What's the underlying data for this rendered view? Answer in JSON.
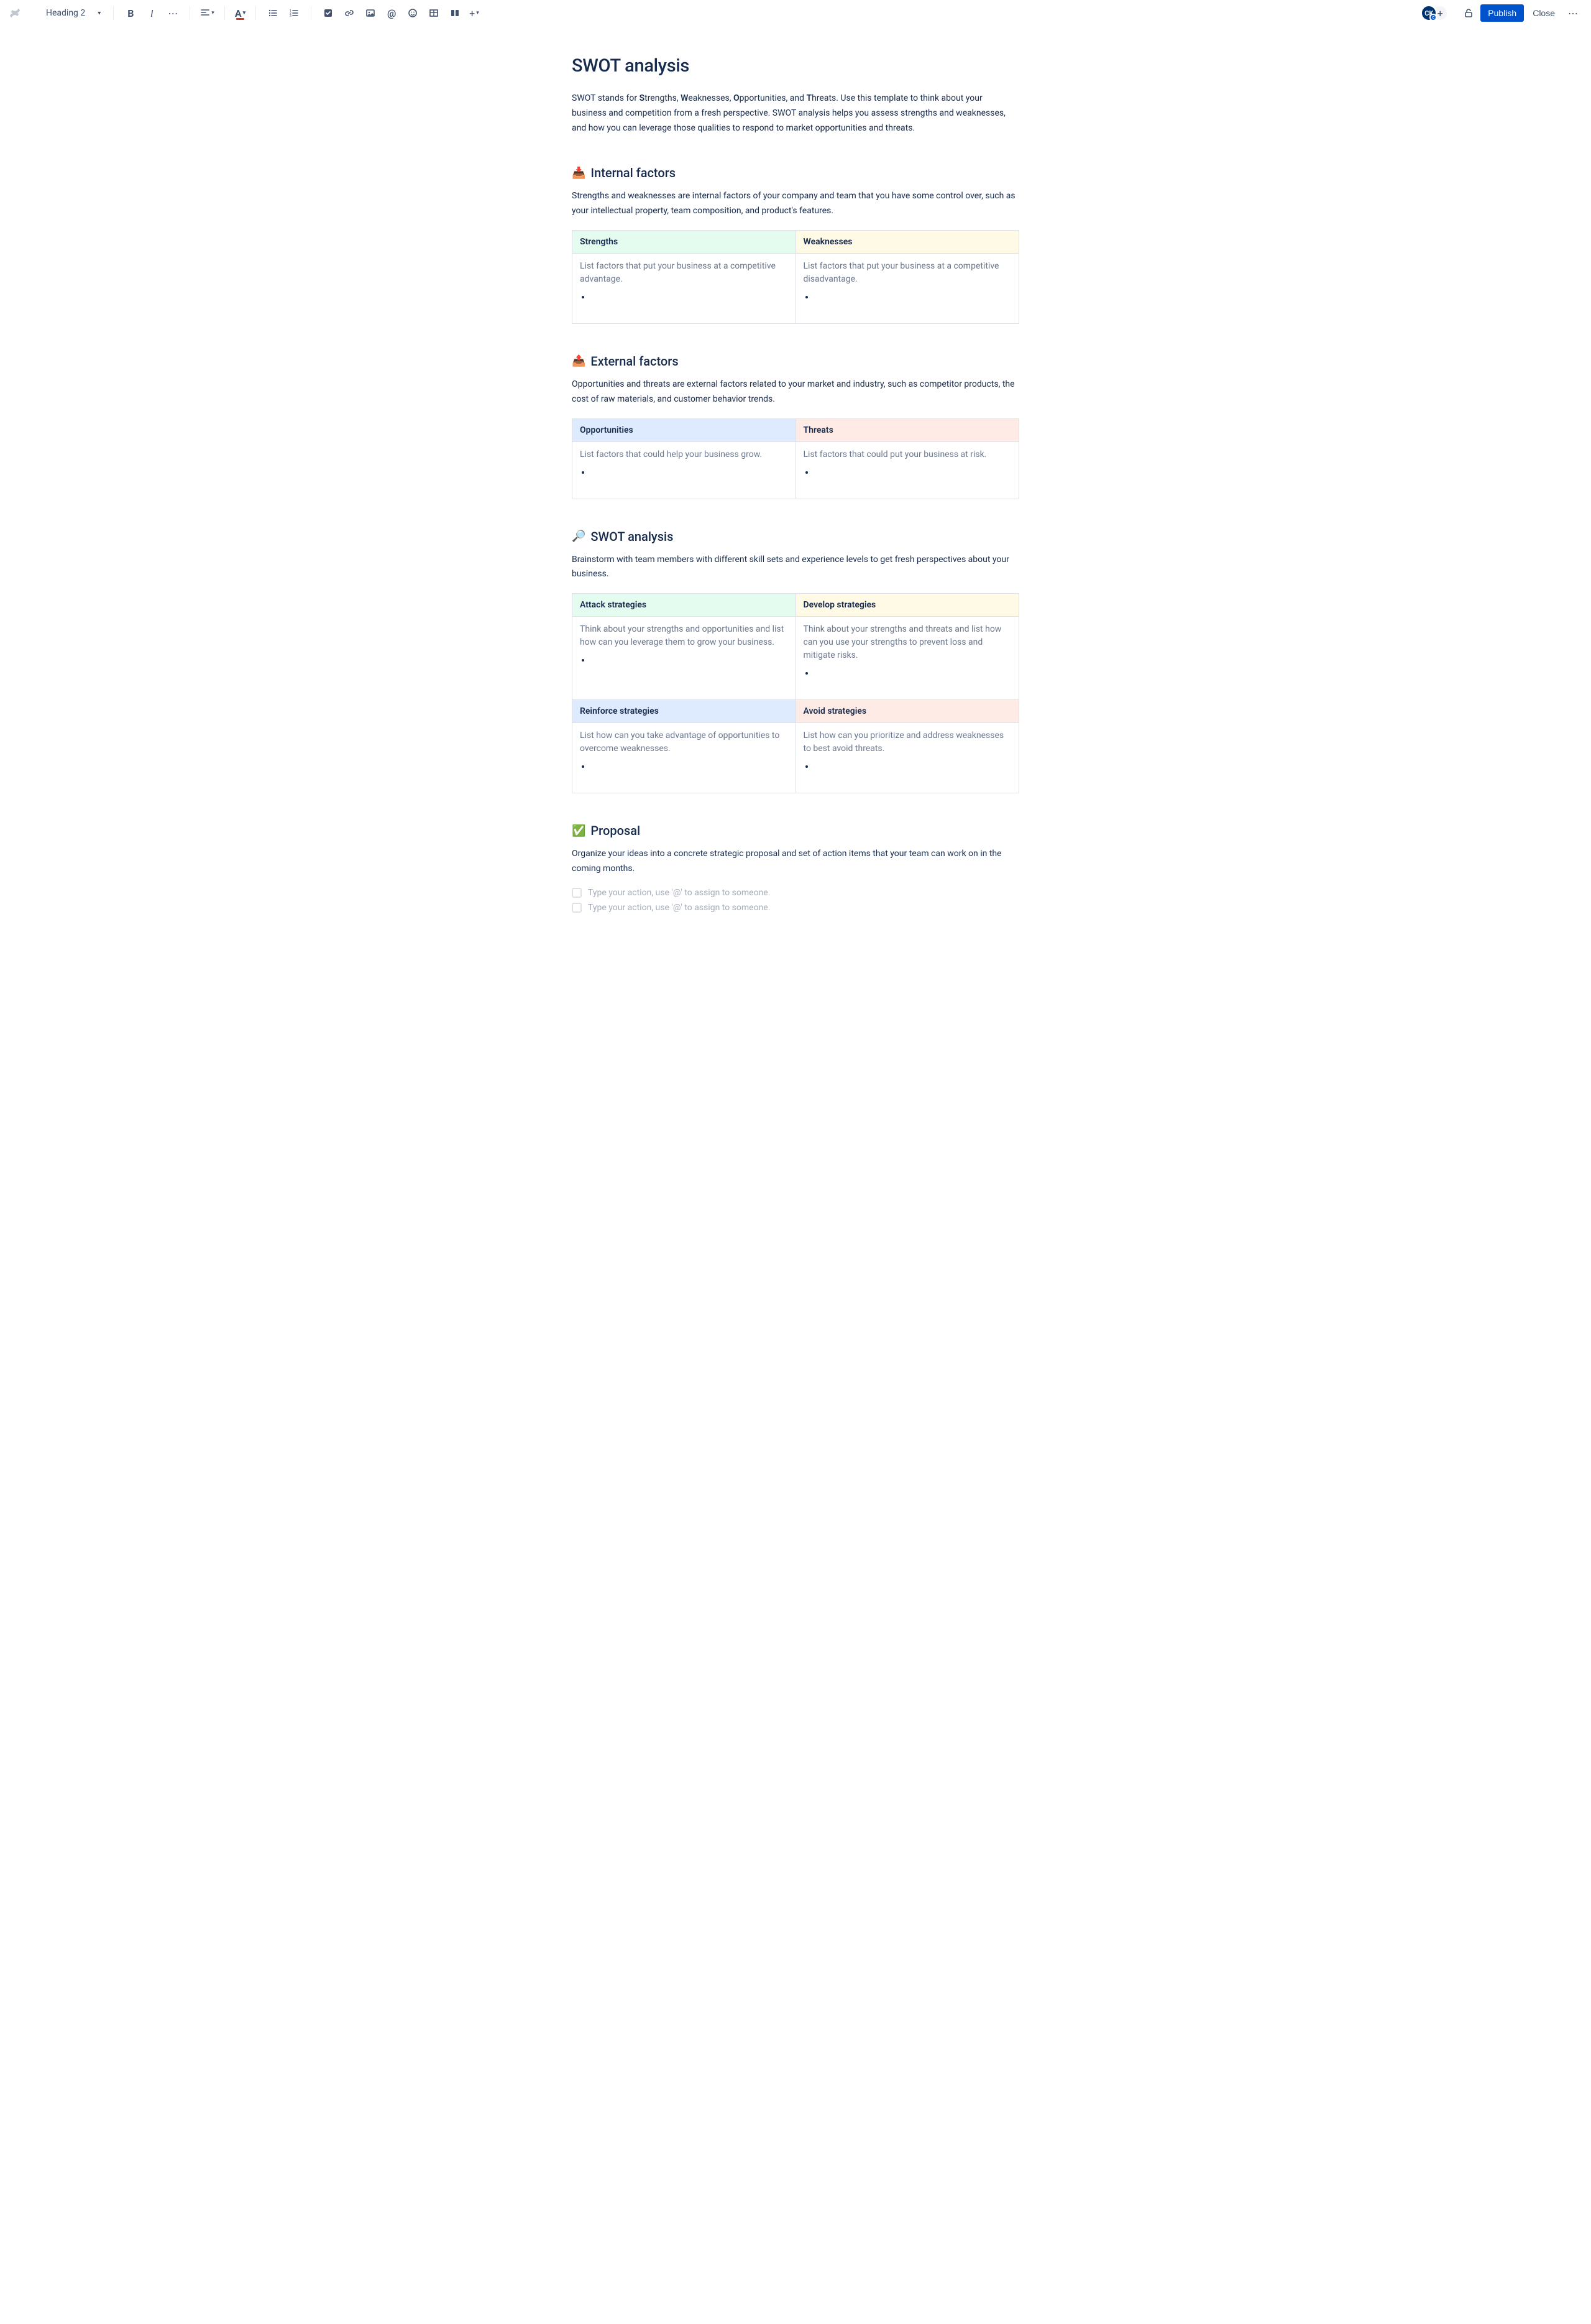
{
  "toolbar": {
    "heading_style": "Heading 2",
    "publish": "Publish",
    "close": "Close",
    "avatar_initials": "CK"
  },
  "page": {
    "title": "SWOT analysis",
    "intro": {
      "pre": "SWOT stands for ",
      "s": "S",
      "s_rest": "trengths, ",
      "w": "W",
      "w_rest": "eaknesses, ",
      "o": "O",
      "o_rest": "pportunities, and ",
      "t": "T",
      "t_rest": "hreats. Use this template to think about your business and competition from a fresh perspective. SWOT analysis helps you assess strengths and weaknesses, and how you can leverage those qualities to respond to market opportunities and threats."
    }
  },
  "internal": {
    "heading": "Internal factors",
    "emoji": "📥",
    "desc": "Strengths and weaknesses are internal factors of your company and team that you have some control over, such as your intellectual property, team composition, and product's features.",
    "strengths_label": "Strengths",
    "weaknesses_label": "Weaknesses",
    "strengths_hint": "List factors that put your business at a competitive advantage.",
    "weaknesses_hint": "List factors that put your business at a competitive disadvantage."
  },
  "external": {
    "heading": "External factors",
    "emoji": "📤",
    "desc": "Opportunities and threats are external factors related to your market and industry, such as competitor products, the cost of raw materials, and customer behavior trends.",
    "opportunities_label": "Opportunities",
    "threats_label": "Threats",
    "opportunities_hint": "List factors that could help your business grow.",
    "threats_hint": "List factors that could put your business at risk."
  },
  "analysis": {
    "heading": "SWOT analysis",
    "emoji": "🔎",
    "desc": "Brainstorm with team members with different skill sets and experience levels to get fresh perspectives about your business.",
    "attack_label": "Attack strategies",
    "develop_label": "Develop strategies",
    "reinforce_label": "Reinforce strategies",
    "avoid_label": "Avoid strategies",
    "attack_hint": "Think about your strengths and opportunities and list how can you leverage them to grow your business.",
    "develop_hint": "Think about your strengths and threats and list how can you use your strengths to prevent loss and mitigate risks.",
    "reinforce_hint": "List how can you take advantage of opportunities to overcome weaknesses.",
    "avoid_hint": "List how can you prioritize and address weaknesses to best avoid threats."
  },
  "proposal": {
    "heading": "Proposal",
    "emoji": "✅",
    "desc": "Organize your ideas into a concrete strategic proposal and set of action items that your team can work on in the coming months.",
    "action_placeholder": "Type your action, use '@' to assign to someone."
  }
}
